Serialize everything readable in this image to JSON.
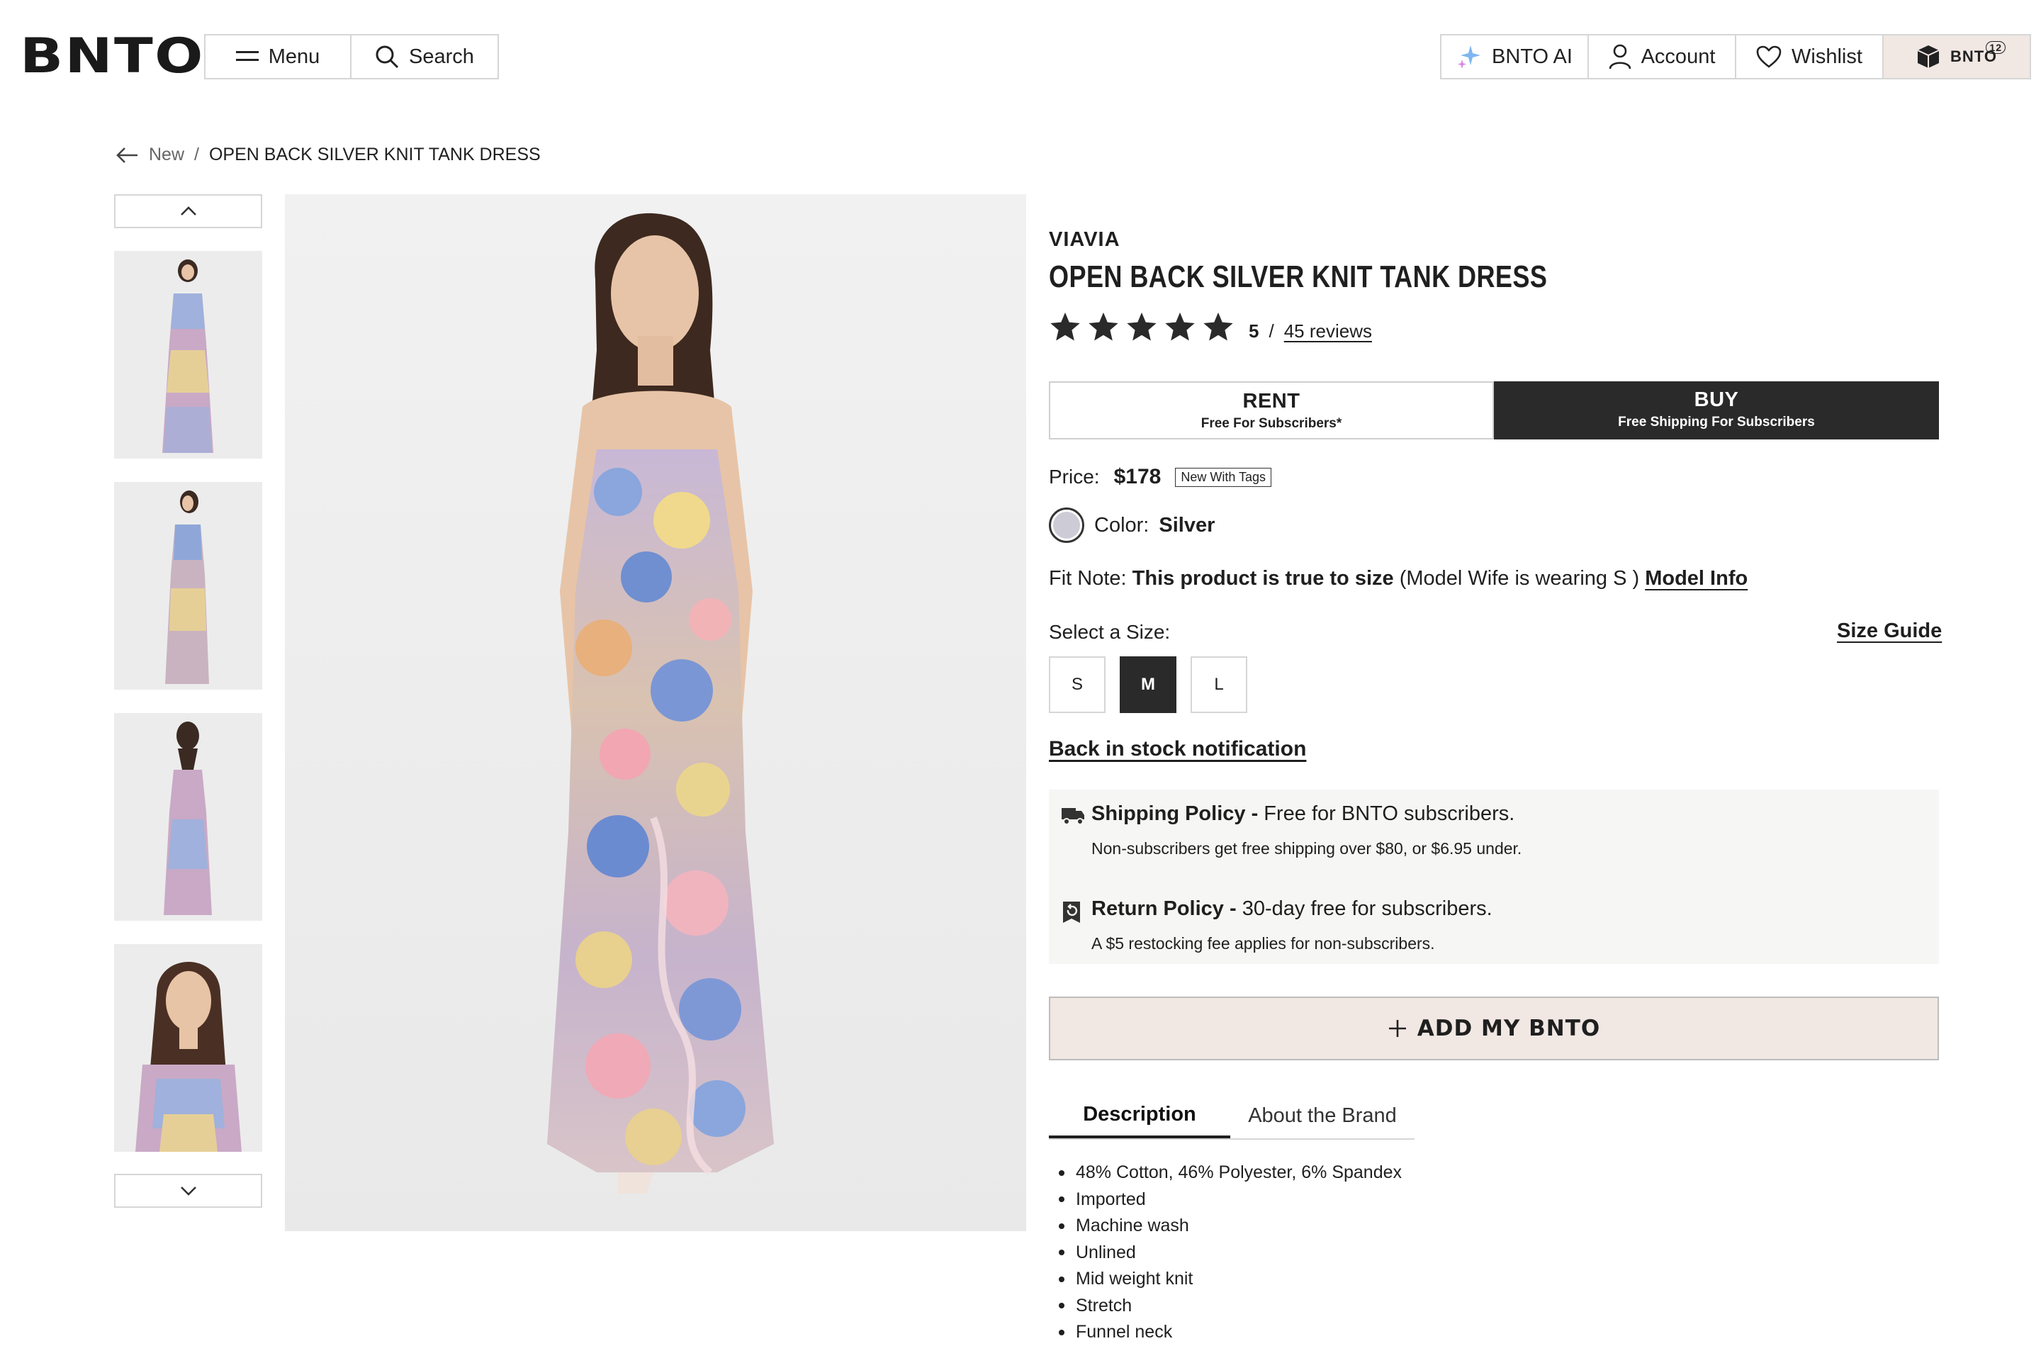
{
  "header": {
    "logo": "BNTO",
    "menu_label": "Menu",
    "search_label": "Search",
    "ai_label": "BNTO AI",
    "account_label": "Account",
    "wishlist_label": "Wishlist",
    "bnto_label": "BNTO",
    "bnto_count": "12"
  },
  "breadcrumb": {
    "parent": "New",
    "separator": "/",
    "current": "OPEN BACK SILVER KNIT TANK DRESS"
  },
  "product": {
    "brand": "VIAVIA",
    "title": "OPEN BACK SILVER KNIT TANK DRESS",
    "rating_value": "5",
    "rating_sep": "/",
    "reviews": "45 reviews",
    "stars_filled": 5,
    "rent": {
      "label": "RENT",
      "sub": "Free For Subscribers*"
    },
    "buy": {
      "label": "BUY",
      "sub": "Free Shipping For Subscribers"
    },
    "price_label": "Price:",
    "price": "$178",
    "condition_tag": "New With Tags",
    "color_label": "Color:",
    "color": "Silver",
    "swatch_hex": "#cdccd6",
    "fit_label": "Fit Note:",
    "fit_bold": "This product is true to size",
    "fit_detail": "(Model Wife is wearing S )",
    "model_info": "Model Info",
    "select_size_label": "Select a Size:",
    "size_guide": "Size Guide",
    "sizes": [
      "S",
      "M",
      "L"
    ],
    "selected_size": "M",
    "back_in_stock": "Back in stock notification"
  },
  "policies": {
    "shipping_title": "Shipping Policy",
    "shipping_dash": " - ",
    "shipping_summary": "Free for BNTO subscribers.",
    "shipping_detail": "Non-subscribers get free shipping over $80, or $6.95 under.",
    "return_title": "Return Policy",
    "return_dash": " - ",
    "return_summary": "30-day free for subscribers.",
    "return_detail": "A $5 restocking fee applies for non-subscribers."
  },
  "add_button": "ADD MY BNTO",
  "tabs": [
    "Description",
    "About the Brand"
  ],
  "description": [
    "48% Cotton, 46% Polyester, 6% Spandex",
    "Imported",
    "Machine wash",
    "Unlined",
    "Mid weight knit",
    "Stretch",
    "Funnel neck"
  ],
  "colors": {
    "accent_dark": "#2a2a2a",
    "cart_bg": "#f1e7e3",
    "policy_bg": "#f6f6f4"
  }
}
